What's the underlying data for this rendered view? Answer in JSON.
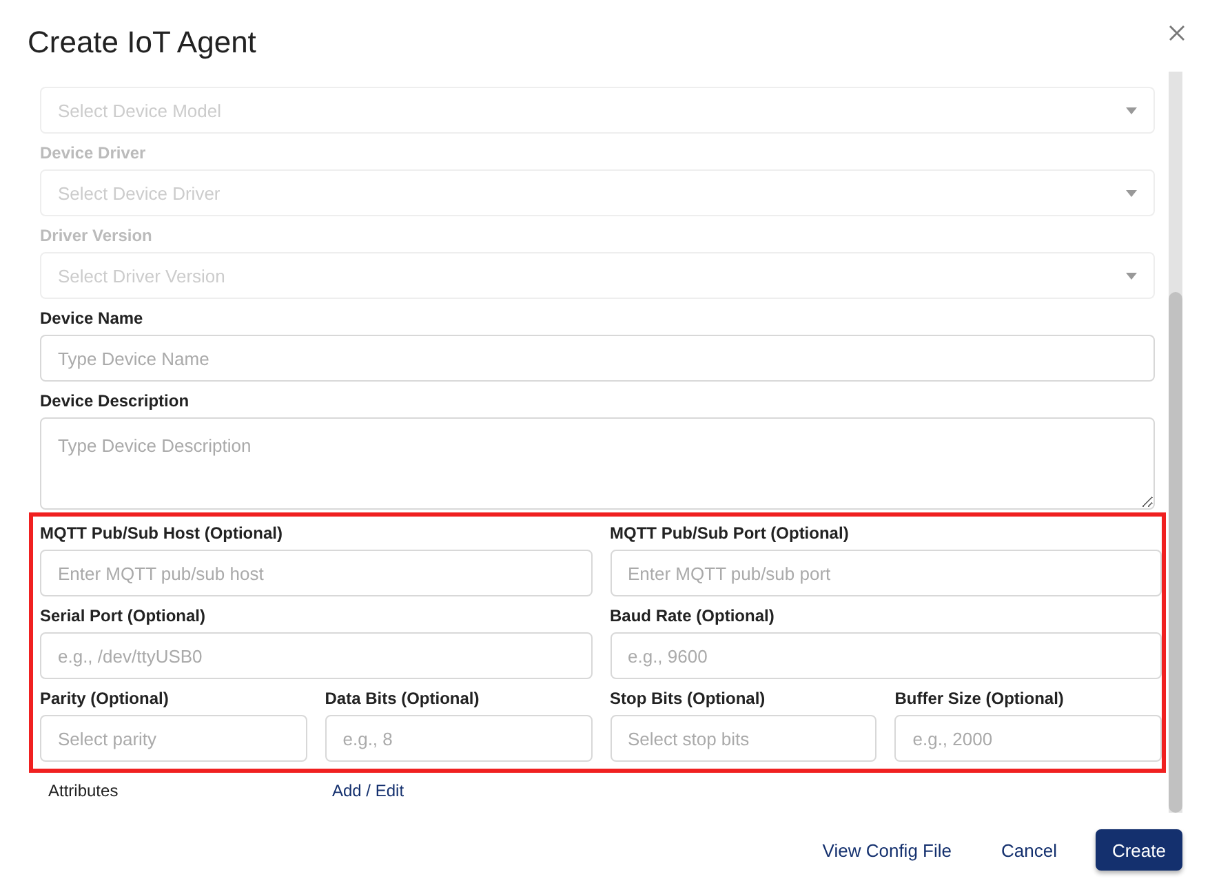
{
  "dialog": {
    "title": "Create IoT Agent"
  },
  "rows": [
    [
      {
        "kind": "select",
        "placeholder": "Select Device Model",
        "disabled": true
      }
    ],
    [
      {
        "kind": "select",
        "label": "Device Driver",
        "placeholder": "Select Device Driver",
        "disabled": true
      }
    ],
    [
      {
        "kind": "select",
        "label": "Driver Version",
        "placeholder": "Select Driver Version",
        "disabled": true
      }
    ],
    [
      {
        "kind": "input",
        "label": "Device Name",
        "placeholder": "Type Device Name",
        "disabled": false
      }
    ],
    [
      {
        "kind": "textarea",
        "label": "Device Description",
        "placeholder": "Type Device Description",
        "disabled": false
      }
    ]
  ],
  "highlighted_rows": [
    [
      {
        "kind": "input",
        "label": "MQTT Pub/Sub Host (Optional)",
        "placeholder": "Enter MQTT pub/sub host",
        "disabled": false
      },
      {
        "kind": "input",
        "label": "MQTT Pub/Sub Port (Optional)",
        "placeholder": "Enter MQTT pub/sub port",
        "disabled": false
      }
    ],
    [
      {
        "kind": "input",
        "label": "Serial Port (Optional)",
        "placeholder": "e.g., /dev/ttyUSB0",
        "disabled": false
      },
      {
        "kind": "input",
        "label": "Baud Rate (Optional)",
        "placeholder": "e.g., 9600",
        "disabled": false
      }
    ],
    [
      {
        "kind": "input",
        "label": "Parity (Optional)",
        "placeholder": "Select parity",
        "disabled": false
      },
      {
        "kind": "input",
        "label": "Data Bits (Optional)",
        "placeholder": "e.g., 8",
        "disabled": false
      },
      {
        "kind": "input",
        "label": "Stop Bits (Optional)",
        "placeholder": "Select stop bits",
        "disabled": false
      },
      {
        "kind": "input",
        "label": "Buffer Size (Optional)",
        "placeholder": "e.g., 2000",
        "disabled": false
      }
    ]
  ],
  "attributes": {
    "label": "Attributes",
    "link": "Add / Edit"
  },
  "footer": {
    "buttons": [
      {
        "label": "View Config File",
        "kind": "text"
      },
      {
        "label": "Cancel",
        "kind": "text"
      },
      {
        "label": "Create",
        "kind": "primary"
      }
    ]
  }
}
